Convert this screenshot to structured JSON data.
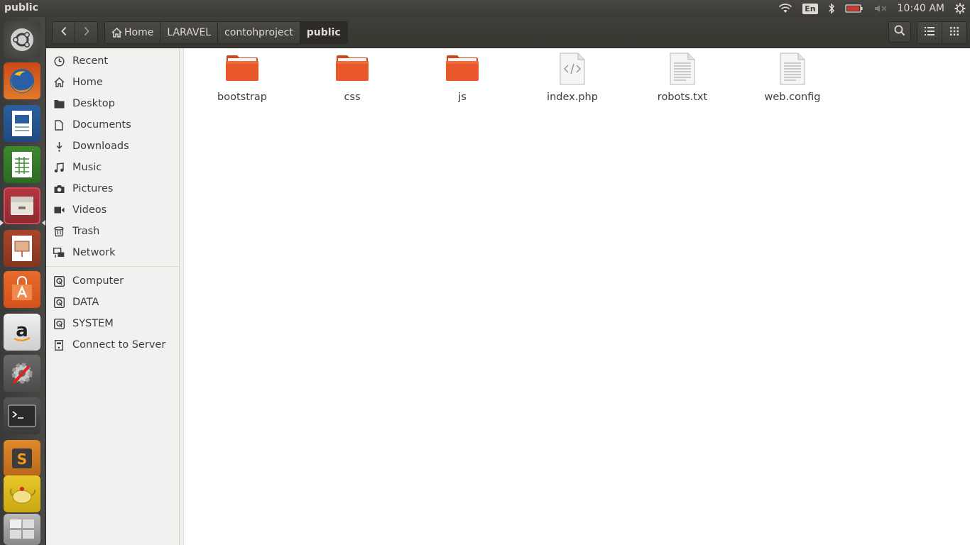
{
  "panel": {
    "app_title": "public",
    "language": "En",
    "clock": "10:40 AM"
  },
  "launcher": {
    "items": [
      {
        "name": "ubuntu-dash-icon"
      },
      {
        "name": "firefox-icon"
      },
      {
        "name": "libreoffice-writer-icon"
      },
      {
        "name": "libreoffice-calc-icon"
      },
      {
        "name": "files-icon"
      },
      {
        "name": "libreoffice-impress-icon"
      },
      {
        "name": "software-center-icon"
      },
      {
        "name": "amazon-icon"
      },
      {
        "name": "system-settings-icon"
      },
      {
        "name": "terminal-icon"
      },
      {
        "name": "sublime-text-icon"
      },
      {
        "name": "teapot-app-icon"
      },
      {
        "name": "workspace-switcher-icon"
      }
    ]
  },
  "toolbar": {
    "back_icon": "chevron-left-icon",
    "forward_icon": "chevron-right-icon",
    "breadcrumb": [
      "Home",
      "LARAVEL",
      "contohproject",
      "public"
    ],
    "search_icon": "search-icon",
    "list_view_icon": "list-view-icon",
    "grid_view_icon": "grid-view-icon"
  },
  "sidebar": {
    "places": [
      {
        "label": "Recent",
        "icon": "clock-icon"
      },
      {
        "label": "Home",
        "icon": "home-icon"
      },
      {
        "label": "Desktop",
        "icon": "desktop-folder-icon"
      },
      {
        "label": "Documents",
        "icon": "document-icon"
      },
      {
        "label": "Downloads",
        "icon": "download-icon"
      },
      {
        "label": "Music",
        "icon": "music-icon"
      },
      {
        "label": "Pictures",
        "icon": "camera-icon"
      },
      {
        "label": "Videos",
        "icon": "video-icon"
      },
      {
        "label": "Trash",
        "icon": "trash-icon"
      },
      {
        "label": "Network",
        "icon": "network-icon"
      }
    ],
    "devices": [
      {
        "label": "Computer",
        "icon": "drive-icon"
      },
      {
        "label": "DATA",
        "icon": "drive-icon"
      },
      {
        "label": "SYSTEM",
        "icon": "drive-icon"
      },
      {
        "label": "Connect to Server",
        "icon": "server-icon"
      }
    ]
  },
  "files": [
    {
      "label": "bootstrap",
      "type": "folder"
    },
    {
      "label": "css",
      "type": "folder"
    },
    {
      "label": "js",
      "type": "folder"
    },
    {
      "label": "index.php",
      "type": "code"
    },
    {
      "label": "robots.txt",
      "type": "text"
    },
    {
      "label": "web.config",
      "type": "text"
    }
  ],
  "colors": {
    "folder": "#e9582a",
    "panel_bg": "#3c3b37",
    "sidebar_bg": "#f2f1f0"
  }
}
